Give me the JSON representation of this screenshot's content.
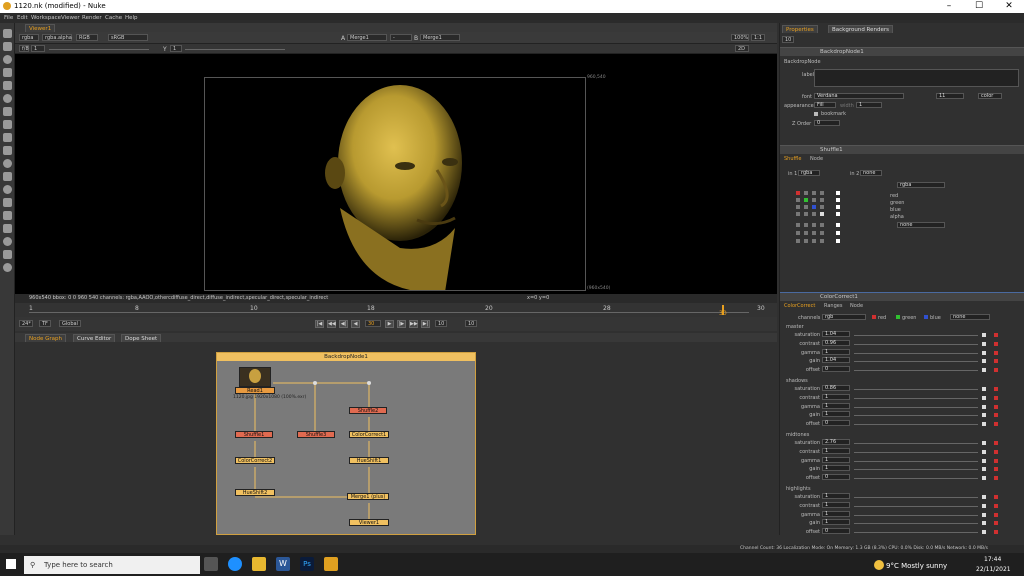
{
  "window": {
    "title": "1120.nk (modified) - Nuke",
    "min": "–",
    "max": "☐",
    "close": "✕"
  },
  "menu": [
    "File",
    "Edit",
    "Workspace",
    "Viewer",
    "Render",
    "Cache",
    "Help"
  ],
  "viewer_tab": "Viewer1",
  "viewer_controls": {
    "channels": "rgba",
    "channel_alpha": "rgba.alpha",
    "colorspace": "RGB",
    "lut": "sRGB",
    "a_label": "A",
    "a_input": "Merge1",
    "dash": "-",
    "b_label": "B",
    "b_input": "Merge1",
    "zoom": "100%",
    "ratio": "1:1",
    "view": "2D",
    "fstop": "f/8",
    "frame": "1",
    "y": "Y",
    "y_val": "1",
    "res_tr": "960,540",
    "res_br": "(960x540)"
  },
  "viewer_status": {
    "left": "960x540  bbox: 0 0 960 540  channels: rgba,AAOO,othercdiffuse_direct,diffuse_indirect,specular_direct,specular_indirect",
    "coords": "x=0 y=0"
  },
  "timeline": {
    "ticks": [
      "1",
      "8",
      "10",
      "18",
      "20",
      "28",
      "30"
    ],
    "marker": "30",
    "end": "30"
  },
  "playback": {
    "fps": "24*",
    "mode": "TF",
    "global": "Global",
    "frame": "30",
    "step": "10",
    "step2": "10"
  },
  "ng_tabs": [
    "Node Graph",
    "Curve Editor",
    "Dope Sheet"
  ],
  "backdrop": {
    "title": "BackdropNode1"
  },
  "nodes": {
    "read": "Read1",
    "read_file": "1120.jpg 1920x1080 (100%.exr)",
    "shuffle2": "Shuffle2",
    "cc1": "ColorCorrect1",
    "hue1": "HueShift1",
    "shuffle1": "Shuffle1",
    "cc2": "ColorCorrect2",
    "hue2": "HueShift2",
    "shuffle3": "Shuffle3",
    "merge": "Merge1 (plus)",
    "viewer": "Viewer1"
  },
  "props_tabs": [
    "Properties",
    "Background Renders"
  ],
  "props_count": "10",
  "backdrop_panel": {
    "name": "BackdropNode1",
    "tab": "BackdropNode",
    "label": "label",
    "font": "font",
    "font_val": "Verdana",
    "font_size": "11",
    "color": "color",
    "appearance": "appearance",
    "appearance_val": "Fill",
    "width": "width",
    "width_val": "1",
    "bookmark": "bookmark",
    "zorder": "Z Order",
    "zorder_val": "0"
  },
  "shuffle_panel": {
    "name": "Shuffle1",
    "tabs": [
      "Shuffle",
      "Node"
    ],
    "in1": "in 1",
    "in1_val": "rgba",
    "in2": "in 2",
    "in2_val": "none",
    "out1": "rgba",
    "out2": "none",
    "outs": [
      "red",
      "green",
      "blue",
      "alpha"
    ]
  },
  "cc_panel": {
    "name": "ColorCorrect1",
    "tabs": [
      "ColorCorrect",
      "Ranges",
      "Node"
    ],
    "channels": "channels",
    "channels_val": "rgb",
    "chk": [
      "red",
      "green",
      "blue"
    ],
    "none": "none",
    "sections": [
      {
        "title": "master",
        "rows": [
          {
            "k": "saturation",
            "v": "1.04"
          },
          {
            "k": "contrast",
            "v": "0.96"
          },
          {
            "k": "gamma",
            "v": "1"
          },
          {
            "k": "gain",
            "v": "1.04"
          },
          {
            "k": "offset",
            "v": "0"
          }
        ]
      },
      {
        "title": "shadows",
        "rows": [
          {
            "k": "saturation",
            "v": "0.86"
          },
          {
            "k": "contrast",
            "v": "1"
          },
          {
            "k": "gamma",
            "v": "1"
          },
          {
            "k": "gain",
            "v": "1"
          },
          {
            "k": "offset",
            "v": "0"
          }
        ]
      },
      {
        "title": "midtones",
        "rows": [
          {
            "k": "saturation",
            "v": "2.76"
          },
          {
            "k": "contrast",
            "v": "1"
          },
          {
            "k": "gamma",
            "v": "1"
          },
          {
            "k": "gain",
            "v": "1"
          },
          {
            "k": "offset",
            "v": "0"
          }
        ]
      },
      {
        "title": "highlights",
        "rows": [
          {
            "k": "saturation",
            "v": "1"
          },
          {
            "k": "contrast",
            "v": "1"
          },
          {
            "k": "gamma",
            "v": "1"
          },
          {
            "k": "gain",
            "v": "1"
          },
          {
            "k": "offset",
            "v": "0"
          }
        ]
      }
    ]
  },
  "status": "Channel Count: 36  Localization Mode: On  Memory: 1.3 GB (8.3%)  CPU: 0.0%  Disk: 0.0 MB/s  Network: 0.0 MB/s",
  "taskbar": {
    "search": "Type here to search",
    "weather": "9°C  Mostly sunny",
    "time": "17:44",
    "date": "22/11/2021",
    "word": "W",
    "ps": "Ps"
  },
  "colors": {
    "accent": "#e8a020",
    "node_red": "#e06a50",
    "node_yellow": "#f0c060",
    "backdrop": "#7a7a7a"
  }
}
